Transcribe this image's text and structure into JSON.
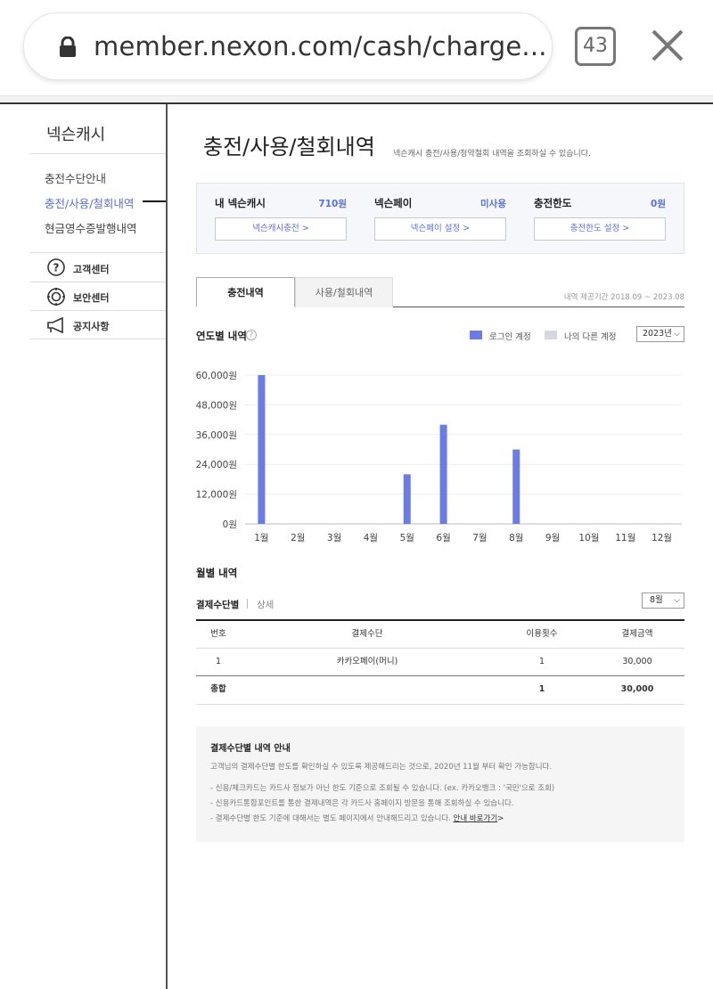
{
  "browser": {
    "url": "member.nexon.com/cash/charge...",
    "tab_count": "43"
  },
  "sidebar": {
    "title": "넥슨캐시",
    "links": [
      {
        "label": "충전수단안내"
      },
      {
        "label": "충전/사용/철회내역"
      },
      {
        "label": "현금영수증발행내역"
      }
    ],
    "items": [
      {
        "label": "고객센터",
        "icon": "question-circle-icon"
      },
      {
        "label": "보안센터",
        "icon": "shield-target-icon"
      },
      {
        "label": "공지사항",
        "icon": "megaphone-icon"
      }
    ]
  },
  "header": {
    "title": "충전/사용/철회내역",
    "description": "넥슨캐시 충전/사용/청약철회 내역을 조회하실 수 있습니다."
  },
  "summary": [
    {
      "label": "내 넥슨캐시",
      "value": "710원",
      "button": "넥슨캐시충전 >"
    },
    {
      "label": "넥슨페이",
      "value": "미사용",
      "button": "넥슨페이 설정 >"
    },
    {
      "label": "충전한도",
      "value": "0원",
      "button": "충전한도 설정 >"
    }
  ],
  "tabs": {
    "active": "충전내역",
    "inactive": "사용/철회내역",
    "period": "내역 제공기간 2018.09 ~ 2023.08"
  },
  "yearly": {
    "title": "연도별 내역",
    "help": "?",
    "legend": [
      {
        "label": "로그인 계정",
        "color": "#6b7ce6"
      },
      {
        "label": "나의 다른 계정",
        "color": "#d5d8e2"
      }
    ],
    "year_select": "2023년"
  },
  "chart_data": {
    "type": "bar",
    "categories": [
      "1월",
      "2월",
      "3월",
      "4월",
      "5월",
      "6월",
      "7월",
      "8월",
      "9월",
      "10월",
      "11월",
      "12월"
    ],
    "series": [
      {
        "name": "로그인 계정",
        "values": [
          60000,
          0,
          0,
          0,
          20000,
          40000,
          0,
          30000,
          0,
          0,
          0,
          0
        ],
        "color": "#6b7ce6"
      }
    ],
    "yticks": [
      "60,000원",
      "48,000원",
      "36,000원",
      "24,000원",
      "12,000원",
      "0원"
    ],
    "ylim": [
      0,
      60000
    ],
    "grid": true
  },
  "monthly": {
    "title": "월별 내역",
    "subtab_active": "결제수단별",
    "subtab_inactive": "상세",
    "month_select": "8월",
    "table": {
      "headers": [
        "번호",
        "결제수단",
        "이용횟수",
        "결제금액"
      ],
      "rows": [
        [
          "1",
          "카카오페이(머니)",
          "1",
          "30,000"
        ]
      ],
      "total": [
        "총합",
        "",
        "1",
        "30,000"
      ]
    }
  },
  "notice": {
    "title": "결제수단별 내역 안내",
    "intro": "고객님의 결제수단별 한도를 확인하실 수 있도록 제공해드리는 것으로, 2020년 11월 부터 확인 가능합니다.",
    "lines": [
      "- 신용/체크카드는 카드사 정보가 아닌 한도 기준으로 조회될 수 있습니다. (ex. 카카오뱅크 : '국민'으로 조회)",
      "- 신용카드통합포인트를 통한 결제내역은 각 카드사 홈페이지 방문을 통해 조회하실 수 있습니다.",
      "- 결제수단별 한도 기준에 대해서는 별도 페이지에서 안내해드리고 있습니다."
    ],
    "link": "안내 바로가기"
  }
}
